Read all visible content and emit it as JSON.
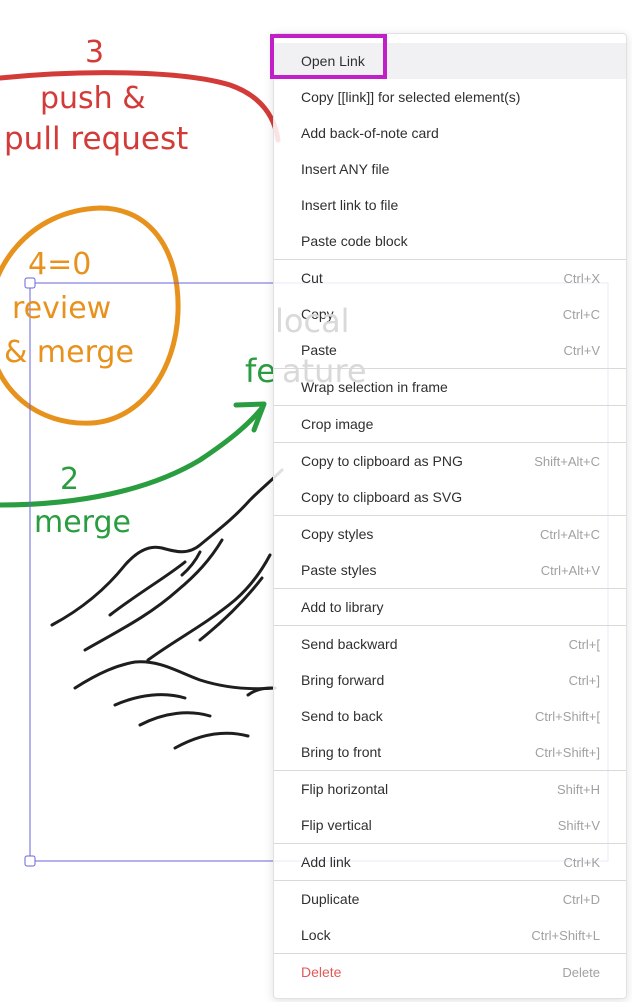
{
  "canvas": {
    "annotations": {
      "step3_number": "3",
      "step3_line1": "push &",
      "step3_line2": "pull request",
      "step4_number": "4=0",
      "step4_line1": "review",
      "step4_line2": "& merge",
      "step2_number": "2",
      "step2_label": "merge",
      "faded_word1": "local",
      "feature_visible": "fe",
      "feature_faded": "ature"
    },
    "colors": {
      "red": "#d33b38",
      "orange": "#e8921e",
      "green": "#2a9d40",
      "selection": "#6965db",
      "marker": "#c11fc8"
    }
  },
  "context_menu": {
    "groups": [
      {
        "items": [
          {
            "label": "Open Link",
            "shortcut": "",
            "highlight": true
          },
          {
            "label": "Copy [[link]] for selected element(s)",
            "shortcut": ""
          },
          {
            "label": "Add back-of-note card",
            "shortcut": ""
          },
          {
            "label": "Insert ANY file",
            "shortcut": ""
          },
          {
            "label": "Insert link to file",
            "shortcut": ""
          },
          {
            "label": "Paste code block",
            "shortcut": ""
          }
        ]
      },
      {
        "items": [
          {
            "label": "Cut",
            "shortcut": "Ctrl+X"
          },
          {
            "label": "Copy",
            "shortcut": "Ctrl+C"
          },
          {
            "label": "Paste",
            "shortcut": "Ctrl+V"
          }
        ]
      },
      {
        "items": [
          {
            "label": "Wrap selection in frame",
            "shortcut": ""
          }
        ]
      },
      {
        "items": [
          {
            "label": "Crop image",
            "shortcut": ""
          }
        ]
      },
      {
        "items": [
          {
            "label": "Copy to clipboard as PNG",
            "shortcut": "Shift+Alt+C"
          },
          {
            "label": "Copy to clipboard as SVG",
            "shortcut": ""
          }
        ]
      },
      {
        "items": [
          {
            "label": "Copy styles",
            "shortcut": "Ctrl+Alt+C"
          },
          {
            "label": "Paste styles",
            "shortcut": "Ctrl+Alt+V"
          }
        ]
      },
      {
        "items": [
          {
            "label": "Add to library",
            "shortcut": ""
          }
        ]
      },
      {
        "items": [
          {
            "label": "Send backward",
            "shortcut": "Ctrl+["
          },
          {
            "label": "Bring forward",
            "shortcut": "Ctrl+]"
          },
          {
            "label": "Send to back",
            "shortcut": "Ctrl+Shift+["
          },
          {
            "label": "Bring to front",
            "shortcut": "Ctrl+Shift+]"
          }
        ]
      },
      {
        "items": [
          {
            "label": "Flip horizontal",
            "shortcut": "Shift+H"
          },
          {
            "label": "Flip vertical",
            "shortcut": "Shift+V"
          }
        ]
      },
      {
        "items": [
          {
            "label": "Add link",
            "shortcut": "Ctrl+K"
          }
        ]
      },
      {
        "items": [
          {
            "label": "Duplicate",
            "shortcut": "Ctrl+D"
          },
          {
            "label": "Lock",
            "shortcut": "Ctrl+Shift+L"
          }
        ]
      },
      {
        "items": [
          {
            "label": "Delete",
            "shortcut": "Delete",
            "danger": true
          }
        ]
      }
    ]
  }
}
